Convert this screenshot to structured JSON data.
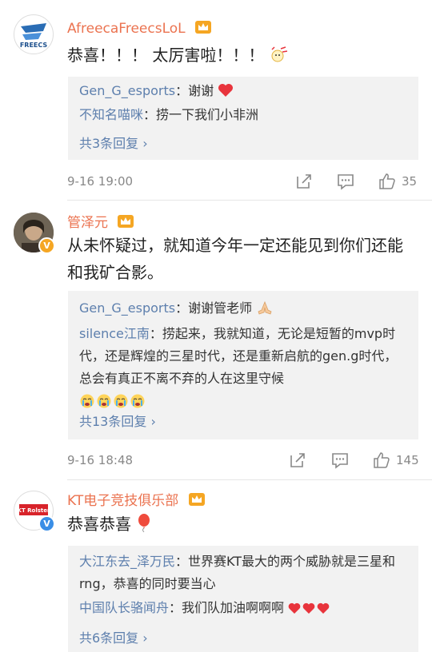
{
  "comments": [
    {
      "username": "AfreecaFreecsLoL",
      "avatar_text": "FREECS",
      "text": "恭喜！！！ 太厉害啦！！！",
      "replies": [
        {
          "name": "Gen_G_esports",
          "text": "：谢谢"
        },
        {
          "name": "不知名喵咪",
          "text": "：捞一下我们小非洲"
        }
      ],
      "more_replies": "共3条回复 ›",
      "time": "9-16 19:00",
      "likes": "35"
    },
    {
      "username": "管泽元",
      "badge": "V",
      "text": "从未怀疑过，就知道今年一定还能见到你们还能和我矿合影。",
      "replies": [
        {
          "name": "Gen_G_esports",
          "text": "：谢谢管老师"
        },
        {
          "name": "silence江南",
          "text": "：捞起来，我就知道，无论是短暂的mvp时代，还是辉煌的三星时代，还是重新启航的gen.g时代，总会有真正不离不弃的人在这里守候"
        }
      ],
      "more_replies": "共13条回复 ›",
      "time": "9-16 18:48",
      "likes": "145"
    },
    {
      "username": "KT电子竞技俱乐部",
      "badge": "V",
      "avatar_text": "KT Rolster",
      "text": "恭喜恭喜",
      "replies": [
        {
          "name": "大江东去_泽万民",
          "text": "：世界赛KT最大的两个威胁就是三星和rng，恭喜的同时要当心"
        },
        {
          "name": "中国队长骆闻舟",
          "text": "：我们队加油啊啊啊"
        }
      ],
      "more_replies": "共6条回复 ›"
    }
  ],
  "colors": {
    "username": "#eb7350",
    "reply_name": "#5d7fad",
    "reply_bg": "#f2f2f2",
    "meta": "#888888",
    "crown": "#f5a623",
    "heart": "#e8343c"
  },
  "icons": [
    "crown-icon",
    "share-icon",
    "comment-icon",
    "like-icon",
    "heart-icon",
    "balloon-icon"
  ]
}
